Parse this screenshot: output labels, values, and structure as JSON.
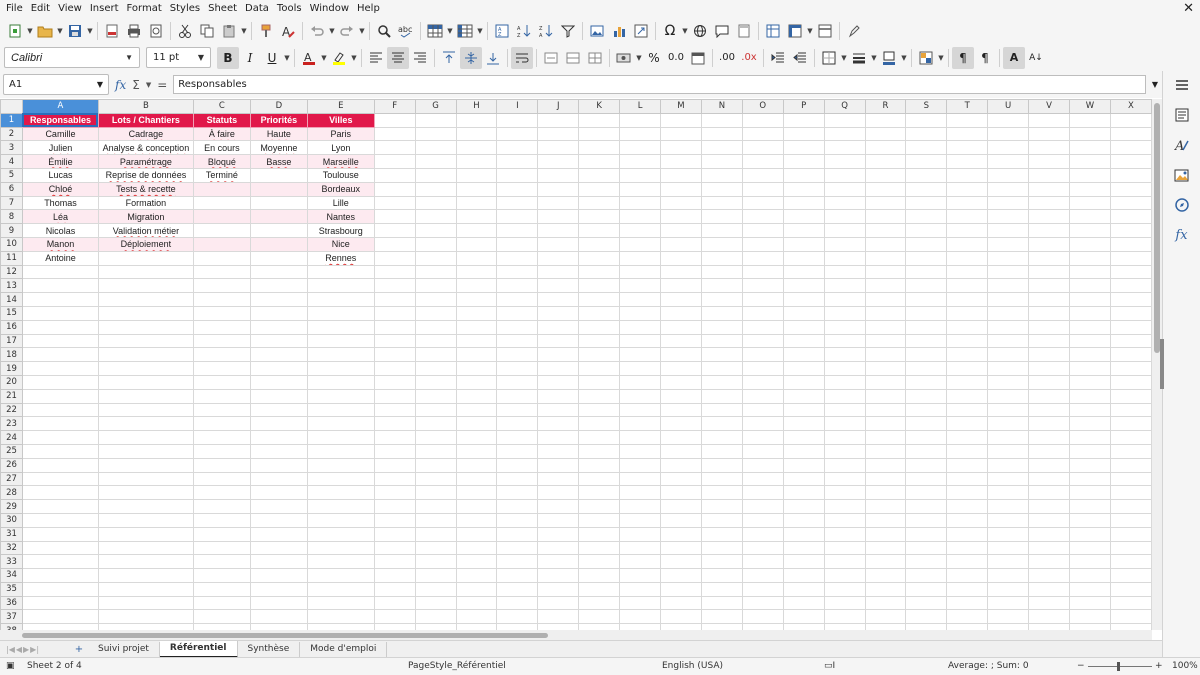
{
  "menu": [
    "File",
    "Edit",
    "View",
    "Insert",
    "Format",
    "Styles",
    "Sheet",
    "Data",
    "Tools",
    "Window",
    "Help"
  ],
  "font": {
    "name": "Calibri",
    "size": "11 pt"
  },
  "namebox": "A1",
  "formula": "Responsables",
  "columns": [
    "A",
    "B",
    "C",
    "D",
    "E",
    "F",
    "G",
    "H",
    "I",
    "J",
    "K",
    "L",
    "M",
    "N",
    "O",
    "P",
    "Q",
    "R",
    "S",
    "T",
    "U",
    "V",
    "W",
    "X"
  ],
  "header_row": [
    "Responsables",
    "Lots / Chantiers",
    "Statuts",
    "Priorités",
    "Villes"
  ],
  "data_rows": [
    [
      "Camille",
      "Cadrage",
      "À faire",
      "Haute",
      "Paris"
    ],
    [
      "Julien",
      "Analyse & conception",
      "En cours",
      "Moyenne",
      "Lyon"
    ],
    [
      "Émilie",
      "Paramétrage",
      "Bloqué",
      "Basse",
      "Marseille"
    ],
    [
      "Lucas",
      "Reprise de données",
      "Terminé",
      "",
      "Toulouse"
    ],
    [
      "Chloé",
      "Tests & recette",
      "",
      "",
      "Bordeaux"
    ],
    [
      "Thomas",
      "Formation",
      "",
      "",
      "Lille"
    ],
    [
      "Léa",
      "Migration",
      "",
      "",
      "Nantes"
    ],
    [
      "Nicolas",
      "Validation métier",
      "",
      "",
      "Strasbourg"
    ],
    [
      "Manon",
      "Déploiement",
      "",
      "",
      "Nice"
    ],
    [
      "Antoine",
      "",
      "",
      "",
      "Rennes"
    ]
  ],
  "visible_row_count": 38,
  "sheet_tabs": [
    "Suivi projet",
    "Référentiel",
    "Synthèse",
    "Mode d'emploi"
  ],
  "active_tab": "Référentiel",
  "status": {
    "sheet": "Sheet 2 of 4",
    "page_style": "PageStyle_Référentiel",
    "language": "English (USA)",
    "summary": "Average: ; Sum: 0",
    "zoom": "100%"
  },
  "colors": {
    "header_fill": "#e1184a",
    "alt_row": "#fdeaf0",
    "selection": "#4a90d9"
  }
}
